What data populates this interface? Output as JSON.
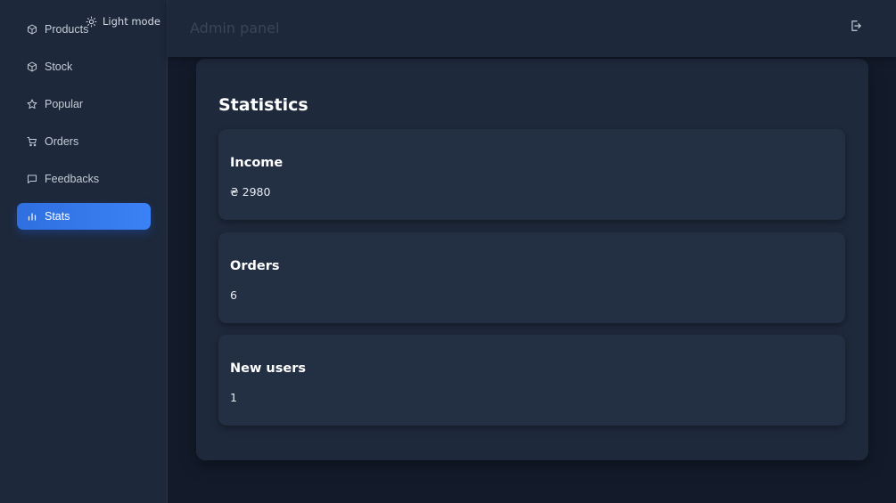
{
  "theme_toggle": {
    "label": "Light mode",
    "icon": "sun-icon"
  },
  "sidebar": {
    "items": [
      {
        "label": "Products",
        "icon": "box-icon"
      },
      {
        "label": "Stock",
        "icon": "box-icon"
      },
      {
        "label": "Popular",
        "icon": "star-icon"
      },
      {
        "label": "Orders",
        "icon": "cart-icon"
      },
      {
        "label": "Feedbacks",
        "icon": "chat-icon"
      },
      {
        "label": "Stats",
        "icon": "bar-chart-icon",
        "active": true
      }
    ]
  },
  "header": {
    "title": "Admin panel",
    "logout_icon": "logout-icon"
  },
  "main": {
    "title": "Statistics",
    "cards": [
      {
        "title": "Income",
        "value": "₴ 2980"
      },
      {
        "title": "Orders",
        "value": "6"
      },
      {
        "title": "New users",
        "value": "1"
      }
    ]
  },
  "colors": {
    "background": "#131b2b",
    "sidebar": "#1d283a",
    "card": "#232f42",
    "accent": "#3b82f6"
  }
}
